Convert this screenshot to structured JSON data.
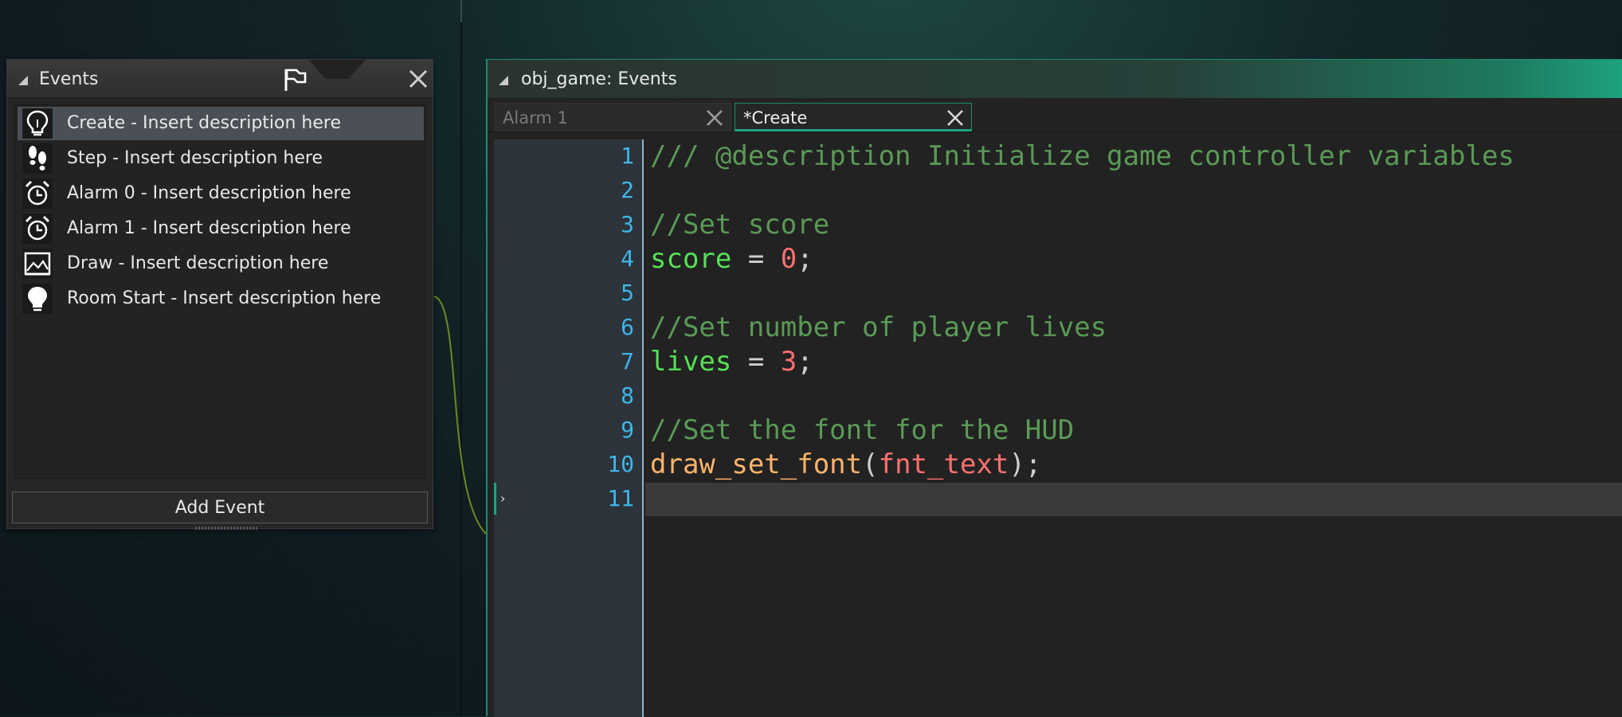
{
  "events_panel": {
    "title": "Events",
    "items": [
      {
        "label": "Create - Insert description here",
        "icon": "lightbulb-outline-icon",
        "selected": true
      },
      {
        "label": "Step - Insert description here",
        "icon": "footsteps-icon",
        "selected": false
      },
      {
        "label": "Alarm 0 - Insert description here",
        "icon": "alarm-clock-icon",
        "selected": false
      },
      {
        "label": "Alarm 1 - Insert description here",
        "icon": "alarm-clock-icon",
        "selected": false
      },
      {
        "label": "Draw - Insert description here",
        "icon": "picture-icon",
        "selected": false
      },
      {
        "label": "Room Start - Insert description here",
        "icon": "lightbulb-filled-icon",
        "selected": false
      }
    ],
    "add_event_label": "Add Event"
  },
  "code_window": {
    "title": "obj_game: Events",
    "tabs": [
      {
        "label": "Alarm 1",
        "active": false
      },
      {
        "label": "*Create",
        "active": true
      }
    ],
    "line_numbers": [
      "1",
      "2",
      "3",
      "4",
      "5",
      "6",
      "7",
      "8",
      "9",
      "10",
      "11"
    ],
    "code": {
      "l1": "/// @description Initialize game controller variables",
      "l3": "//Set score",
      "l4_var": "score",
      "l4_op": " = ",
      "l4_num": "0",
      "l4_end": ";",
      "l6": "//Set number of player lives",
      "l7_var": "lives",
      "l7_op": " = ",
      "l7_num": "3",
      "l7_end": ";",
      "l9": "//Set the font for the HUD",
      "l10_fn": "draw_set_font",
      "l10_open": "(",
      "l10_arg": "fnt_text",
      "l10_close": ");"
    },
    "current_line": "11"
  },
  "colors": {
    "accent": "#1ea27f",
    "line_number": "#3fb6e8",
    "comment": "#5a9a56",
    "variable": "#55e055",
    "number": "#ff7070",
    "function": "#ffb36b"
  }
}
